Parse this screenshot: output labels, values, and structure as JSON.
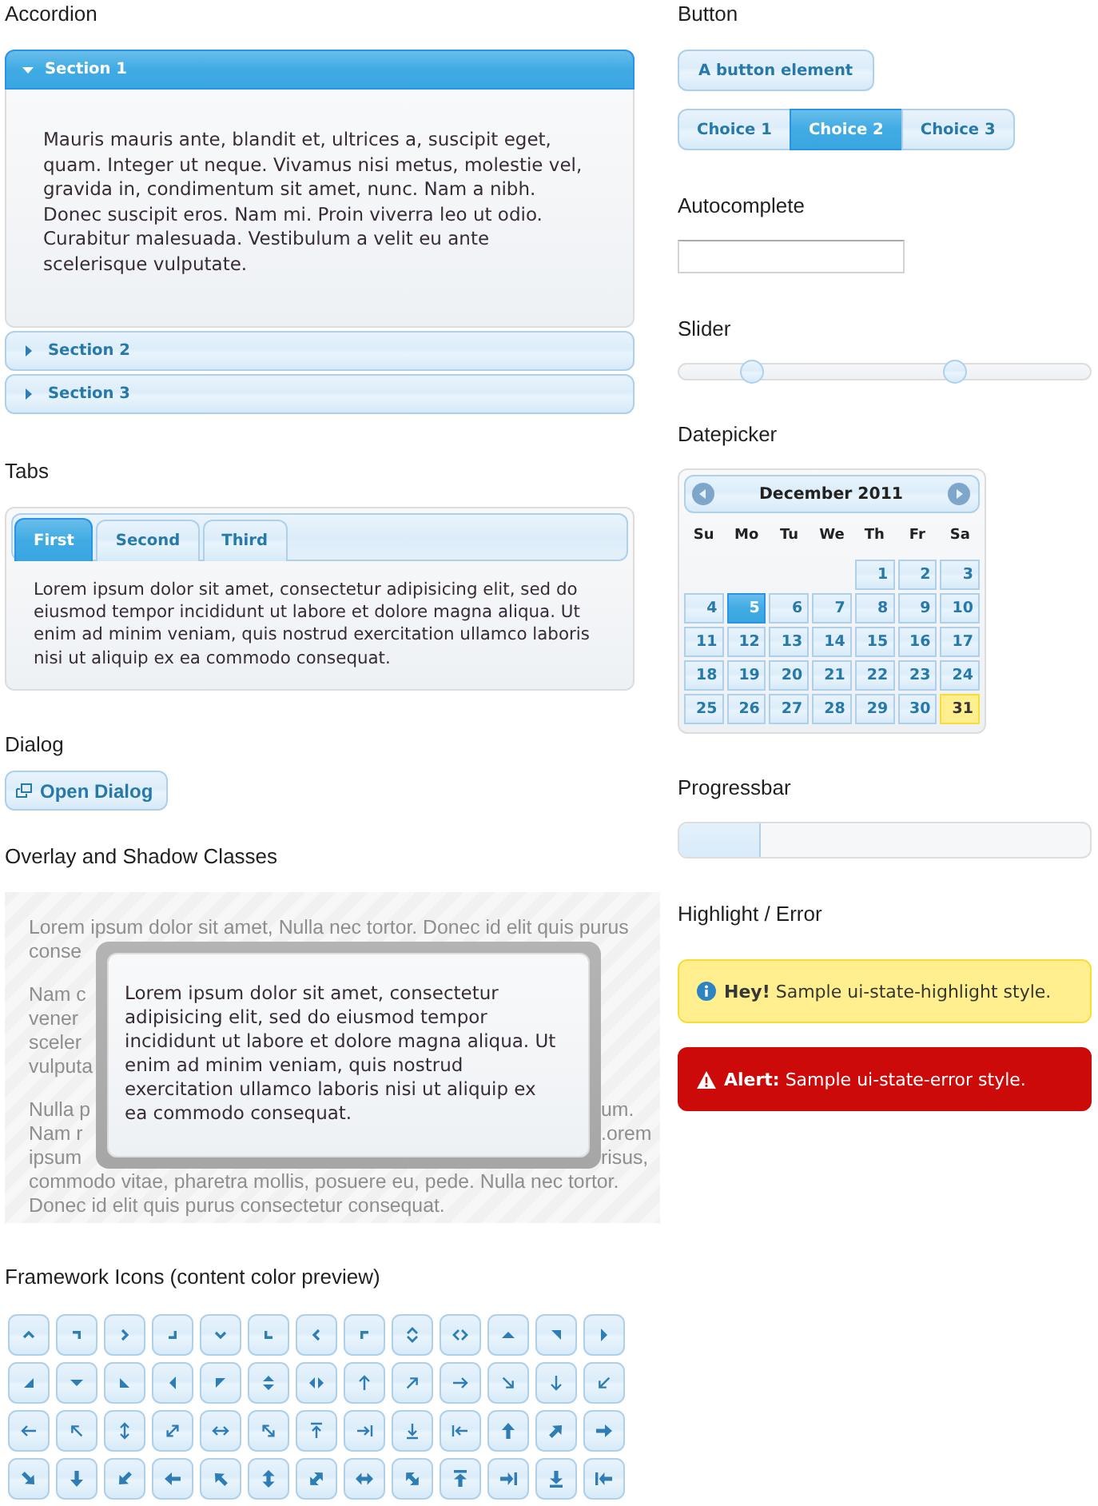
{
  "accordion": {
    "heading": "Accordion",
    "sections": [
      {
        "title": "Section 1",
        "expanded": true,
        "content": "Mauris mauris ante, blandit et, ultrices a, suscipit eget, quam. Integer ut neque. Vivamus nisi metus, molestie vel, gravida in, condimentum sit amet, nunc. Nam a nibh. Donec suscipit eros. Nam mi. Proin viverra leo ut odio. Curabitur malesuada. Vestibulum a velit eu ante scelerisque vulputate."
      },
      {
        "title": "Section 2",
        "expanded": false
      },
      {
        "title": "Section 3",
        "expanded": false
      }
    ]
  },
  "tabs": {
    "heading": "Tabs",
    "items": [
      {
        "label": "First",
        "selected": true
      },
      {
        "label": "Second",
        "selected": false
      },
      {
        "label": "Third",
        "selected": false
      }
    ],
    "content": "Lorem ipsum dolor sit amet, consectetur adipisicing elit, sed do eiusmod tempor incididunt ut labore et dolore magna aliqua. Ut enim ad minim veniam, quis nostrud exercitation ullamco laboris nisi ut aliquip ex ea commodo consequat."
  },
  "dialog": {
    "heading": "Dialog",
    "button": "Open Dialog"
  },
  "overlay": {
    "heading": "Overlay and Shadow Classes",
    "background": [
      [
        {
          "kind": "full",
          "text": "Lorem ipsum dolor sit amet, Nulla nec tortor. Donec id elit quis purus"
        },
        {
          "kind": "split",
          "left": "conse"
        }
      ],
      [
        {
          "kind": "split",
          "left": "Nam c"
        },
        {
          "kind": "split",
          "left": "vener"
        },
        {
          "kind": "split",
          "left": "sceler"
        },
        {
          "kind": "split",
          "left": "vulputa"
        }
      ],
      [
        {
          "kind": "split",
          "left": "Nulla p",
          "right": "um."
        },
        {
          "kind": "split",
          "left": "Nam r",
          "right": ".orem"
        },
        {
          "kind": "split",
          "left": "ipsum",
          "right": "risus,"
        },
        {
          "kind": "full",
          "text": "commodo vitae, pharetra mollis, posuere eu, pede. Nulla nec tortor."
        },
        {
          "kind": "full",
          "text": "Donec id elit quis purus consectetur consequat."
        }
      ]
    ],
    "dialog_text": "Lorem ipsum dolor sit amet, consectetur adipisicing elit, sed do eiusmod tempor incididunt ut labore et dolore magna aliqua. Ut enim ad minim veniam, quis nostrud exercitation ullamco laboris nisi ut aliquip ex ea commodo consequat."
  },
  "framework_icons": {
    "heading": "Framework Icons (content color preview)"
  },
  "button": {
    "heading": "Button",
    "button": "A button element",
    "choices": [
      {
        "label": "Choice 1",
        "selected": false
      },
      {
        "label": "Choice 2",
        "selected": true
      },
      {
        "label": "Choice 3",
        "selected": false
      }
    ]
  },
  "autocomplete": {
    "heading": "Autocomplete"
  },
  "slider": {
    "heading": "Slider",
    "handles": [
      {
        "level": 0.18
      },
      {
        "level": 0.67
      }
    ]
  },
  "datepicker": {
    "heading": "Datepicker",
    "title": "December 2011",
    "weekdays": [
      "Su",
      "Mo",
      "Tu",
      "We",
      "Th",
      "Fr",
      "Sa"
    ],
    "weeks": [
      [
        {
          "day": "1",
          "selected": false,
          "today": false
        },
        {
          "day": "2",
          "selected": false,
          "today": false
        },
        {
          "day": "3",
          "selected": false,
          "today": false
        }
      ],
      [
        {
          "day": "4",
          "selected": false,
          "today": false
        },
        {
          "day": "5",
          "selected": true,
          "today": false
        },
        {
          "day": "6",
          "selected": false,
          "today": false
        },
        {
          "day": "7",
          "selected": false,
          "today": false
        },
        {
          "day": "8",
          "selected": false,
          "today": false
        },
        {
          "day": "9",
          "selected": false,
          "today": false
        },
        {
          "day": "10",
          "selected": false,
          "today": false
        }
      ],
      [
        {
          "day": "11",
          "selected": false,
          "today": false
        },
        {
          "day": "12",
          "selected": false,
          "today": false
        },
        {
          "day": "13",
          "selected": false,
          "today": false
        },
        {
          "day": "14",
          "selected": false,
          "today": false
        },
        {
          "day": "15",
          "selected": false,
          "today": false
        },
        {
          "day": "16",
          "selected": false,
          "today": false
        },
        {
          "day": "17",
          "selected": false,
          "today": false
        }
      ],
      [
        {
          "day": "18",
          "selected": false,
          "today": false
        },
        {
          "day": "19",
          "selected": false,
          "today": false
        },
        {
          "day": "20",
          "selected": false,
          "today": false
        },
        {
          "day": "21",
          "selected": false,
          "today": false
        },
        {
          "day": "22",
          "selected": false,
          "today": false
        },
        {
          "day": "23",
          "selected": false,
          "today": false
        },
        {
          "day": "24",
          "selected": false,
          "today": false
        }
      ],
      [
        {
          "day": "25",
          "selected": false,
          "today": false
        },
        {
          "day": "26",
          "selected": false,
          "today": false
        },
        {
          "day": "27",
          "selected": false,
          "today": false
        },
        {
          "day": "28",
          "selected": false,
          "today": false
        },
        {
          "day": "29",
          "selected": false,
          "today": false
        },
        {
          "day": "30",
          "selected": false,
          "today": false
        },
        {
          "day": "31",
          "selected": false,
          "today": true
        }
      ]
    ]
  },
  "progressbar": {
    "heading": "Progressbar",
    "level": 0.2
  },
  "messages": {
    "heading": "Highlight / Error",
    "items": [
      {
        "kind": "highlight",
        "text": "**Hey!** Sample ui-state-highlight style."
      },
      {
        "kind": "error",
        "text": "**Alert:** Sample ui-state-error style."
      }
    ]
  }
}
